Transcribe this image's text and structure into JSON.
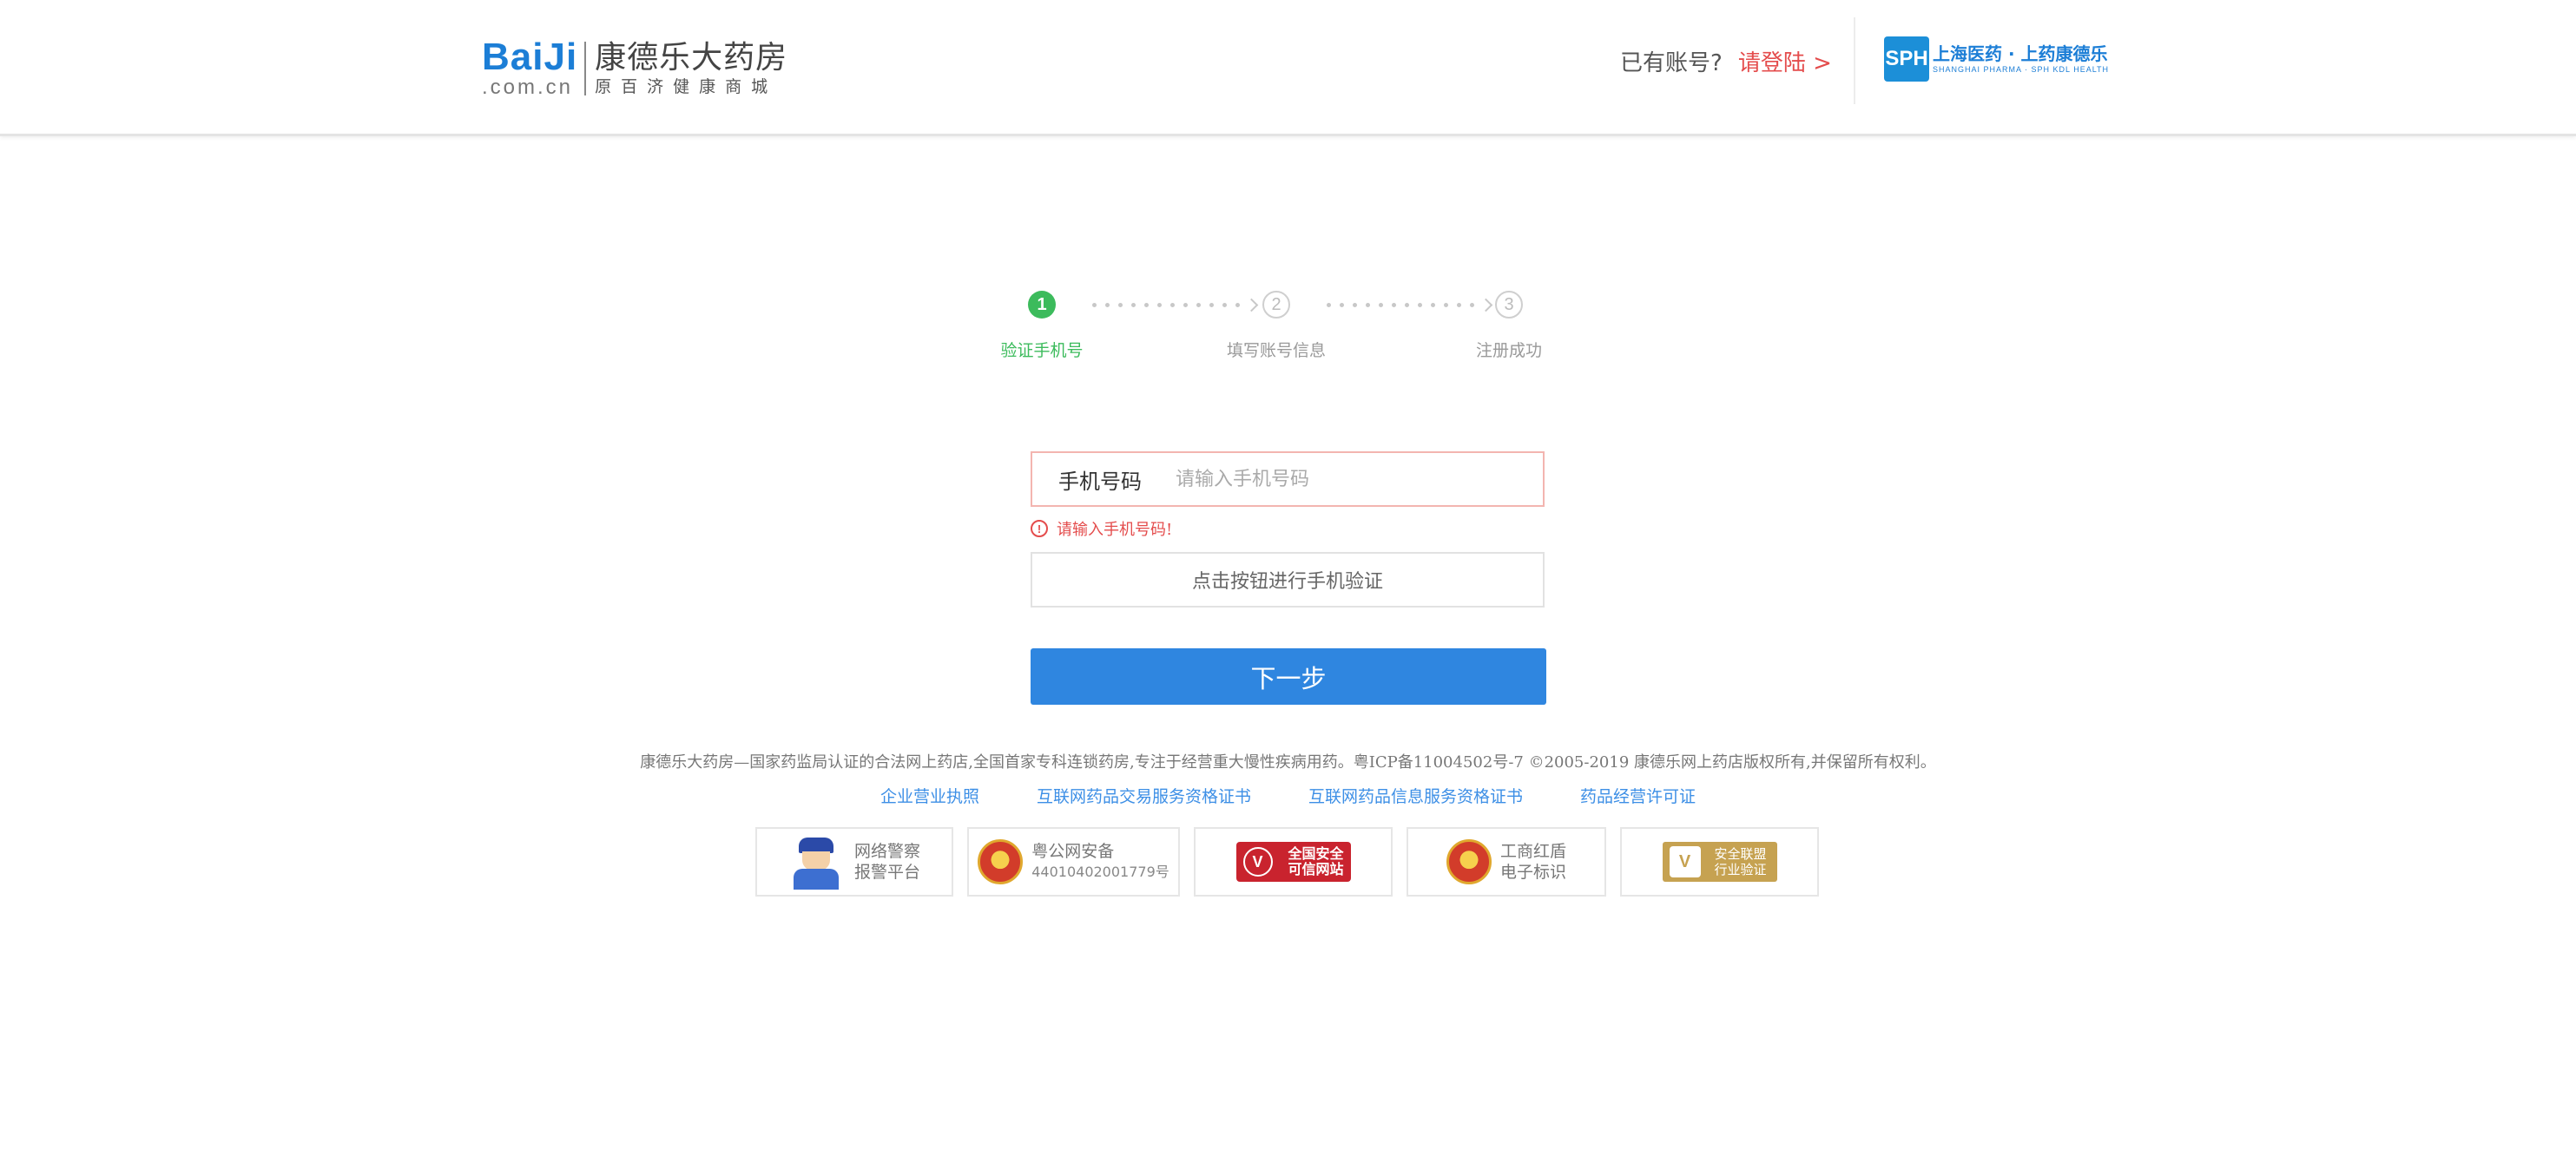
{
  "header": {
    "logo_text": "BaiJi",
    "logo_domain": ".com.cn",
    "logo_name": "康德乐大药房",
    "logo_tagline": "原百济健康商城",
    "have_account_text": "已有账号?",
    "login_link": "请登陆 >",
    "partner_logo_box": "SPH",
    "partner_logo_cn": "上海医药 · 上药康德乐",
    "partner_logo_en": "SHANGHAI PHARMA · SPH KDL HEALTH"
  },
  "steps": [
    {
      "number": "1",
      "label": "验证手机号",
      "active": true
    },
    {
      "number": "2",
      "label": "填写账号信息",
      "active": false
    },
    {
      "number": "3",
      "label": "注册成功",
      "active": false
    }
  ],
  "form": {
    "phone_label": "手机号码",
    "phone_placeholder": "请输入手机号码",
    "phone_value": "",
    "error_icon": "!",
    "error_text": "请输入手机号码!",
    "verify_button": "点击按钮进行手机验证",
    "next_button": "下一步"
  },
  "footer": {
    "copyright": "康德乐大药房—国家药监局认证的合法网上药店,全国首家专科连锁药房,专注于经营重大慢性疾病用药。粤ICP备11004502号-7 ©2005-2019 康德乐网上药店版权所有,并保留所有权利。",
    "links": [
      "企业营业执照",
      "互联网药品交易服务资格证书",
      "互联网药品信息服务资格证书",
      "药品经营许可证"
    ],
    "badges": [
      {
        "icon": "police-icon",
        "line1": "网络警察",
        "line2": "报警平台"
      },
      {
        "icon": "emblem-icon",
        "line1": "粤公网安备",
        "line2": "44010402001779号"
      },
      {
        "icon": "verified-site-icon",
        "line1": "全国安全",
        "line2": "可信网站"
      },
      {
        "icon": "emblem-icon",
        "line1": "工商红盾",
        "line2": "电子标识"
      },
      {
        "icon": "verified-industry-icon",
        "line1": "安全联盟",
        "line2": "行业验证"
      }
    ]
  },
  "colors": {
    "brand_blue": "#2f86e0",
    "step_active_green": "#3cbb5c",
    "error_red": "#e44c4c",
    "link_blue": "#3d8fe6"
  }
}
